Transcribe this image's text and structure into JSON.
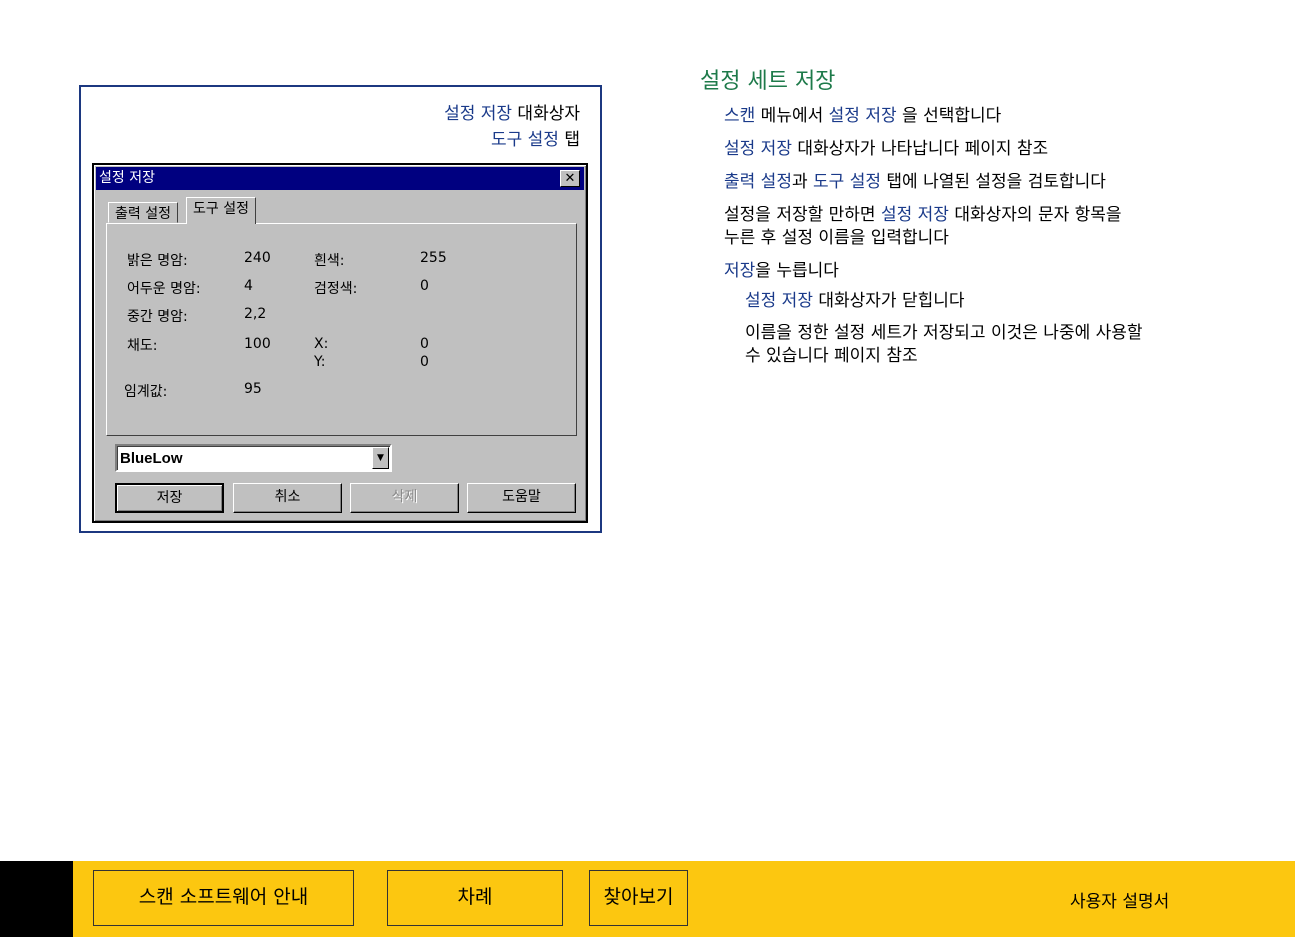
{
  "figure": {
    "caption_line1_name": "설정 저장",
    "caption_line1_rest": " 대화상자",
    "caption_line2_name": "도구 설정",
    "caption_line2_rest": " 탭"
  },
  "dialog": {
    "title": "설정 저장",
    "close_glyph": "✕",
    "tabs": [
      "출력 설정",
      "도구 설정"
    ],
    "fields": {
      "bright_label": "밝은 명암:",
      "bright_value": "240",
      "dark_label": "어두운 명암:",
      "dark_value": "4",
      "mid_label": "중간 명암:",
      "mid_value": "2,2",
      "saturation_label": "채도:",
      "saturation_value": "100",
      "threshold_label": "임계값:",
      "threshold_value": "95",
      "white_label": "흰색:",
      "white_value": "255",
      "black_label": "검정색:",
      "black_value": "0",
      "x_label": "X:",
      "x_value": "0",
      "y_label": "Y:",
      "y_value": "0"
    },
    "selected_setting": "BlueLow",
    "buttons": {
      "save": "저장",
      "cancel": "취소",
      "delete": "삭제",
      "help": "도움말"
    }
  },
  "content": {
    "heading": "설정 세트 저장",
    "steps": {
      "s1_a": "스캔",
      "s1_b": " 메뉴에서 ",
      "s1_c": "설정 저장",
      "s1_d": "  을 선택합니다",
      "s2_a": "설정 저장",
      "s2_b": " 대화상자가 나타납니다      페이지 참조",
      "s3_a": "출력 설정",
      "s3_b": "과 ",
      "s3_c": "도구 설정",
      "s3_d": " 탭에 나열된 설정을 검토합니다",
      "s4_a": "설정을 저장할 만하면 ",
      "s4_b": "설정 저장",
      "s4_c": " 대화상자의 문자 항목을",
      "s4_line2": "누른 후 설정 이름을 입력합니다",
      "s5_a": "저장",
      "s5_b": "을 누릅니다",
      "s6_a": "설정 저장",
      "s6_b": " 대화상자가 닫힙니다",
      "s7_line1": "이름을 정한 설정 세트가 저장되고 이것은 나중에 사용할",
      "s7_line2": "수 있습니다      페이지 참조"
    }
  },
  "footer": {
    "guide": "스캔 소프트웨어 안내",
    "toc": "차례",
    "index": "찾아보기",
    "manual": "사용자 설명서"
  },
  "colors": {
    "accent_blue": "#1a3a8a",
    "heading_green": "#1e7a4a",
    "footer_yellow": "#fcc710",
    "title_bar": "#000080"
  }
}
